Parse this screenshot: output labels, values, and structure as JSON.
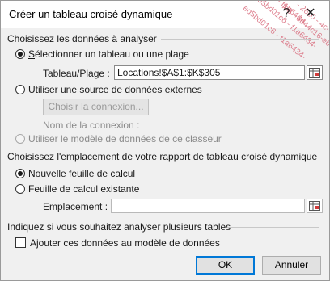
{
  "dialog": {
    "title": "Créer un tableau croisé dynamique",
    "help_label": "?",
    "close_label": "✕",
    "watermark_lines": [
      "d5bd01c6 - f1a6434-",
      "8 - f1a6434-",
      "ed5bd01c6 - f1a6434-",
      "fd5 - 6d44c16-eb7c-",
      "- 26c0 - 4c-"
    ]
  },
  "source_section": {
    "heading": "Choisissez les données à analyser",
    "option_table": "Sélectionner un tableau ou une plage",
    "range_label": "Tableau/Plage :",
    "range_value": "Locations!$A$1:$K$305",
    "option_external": "Utiliser une source de données externes",
    "choose_connection_button": "Choisir la connexion...",
    "connection_name_label": "Nom de la connexion :",
    "option_data_model": "Utiliser le modèle de données de ce classeur"
  },
  "destination_section": {
    "heading": "Choisissez l'emplacement de votre rapport de tableau croisé dynamique",
    "option_new_sheet": "Nouvelle feuille de calcul",
    "option_existing_sheet": "Feuille de calcul existante",
    "location_label": "Emplacement :",
    "location_value": ""
  },
  "multi_table_section": {
    "heading": "Indiquez si vous souhaitez analyser plusieurs tables",
    "add_to_model_label": "Ajouter ces données au modèle de données"
  },
  "buttons": {
    "ok": "OK",
    "cancel": "Annuler"
  },
  "colors": {
    "accent": "#0078d7",
    "dialog_background": "#f0f0f0",
    "disabled_text": "#8a8a8a"
  }
}
